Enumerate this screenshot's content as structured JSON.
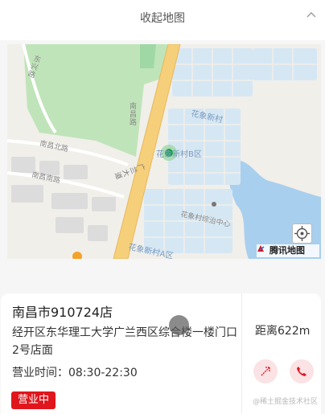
{
  "header": {
    "collapse_label": "收起地图"
  },
  "map": {
    "labels": {
      "dongjing_rd": "东\n兴\n路",
      "nanchang_rd": "南\n昌\n路",
      "guangsha": "广\n兰\n大\n道",
      "nanchang_bei": "南昌北路",
      "nanchang_nan": "南昌南路",
      "xinhua_village": "花象新村",
      "xinhua_b": "花象新村B区",
      "clinic": "花象村综治中心",
      "xinhua_a": "花象新村A区"
    },
    "provider_logo": "腾讯地图",
    "colors": {
      "water": "#a9cfee",
      "park": "#bfe4b9",
      "road_main": "#f6cf7a",
      "block": "#d6e7f4"
    }
  },
  "store": {
    "name": "南昌市910724店",
    "address": "经开区东华理工大学广兰西区综合楼一楼门口2号店面",
    "hours": "营业时间：08:30-22:30",
    "status": "营业中",
    "distance": "距离622m"
  },
  "actions": {
    "navigate_icon": "navigate-icon",
    "phone_icon": "phone-icon"
  },
  "watermark": "@稀土掘金技术社区"
}
